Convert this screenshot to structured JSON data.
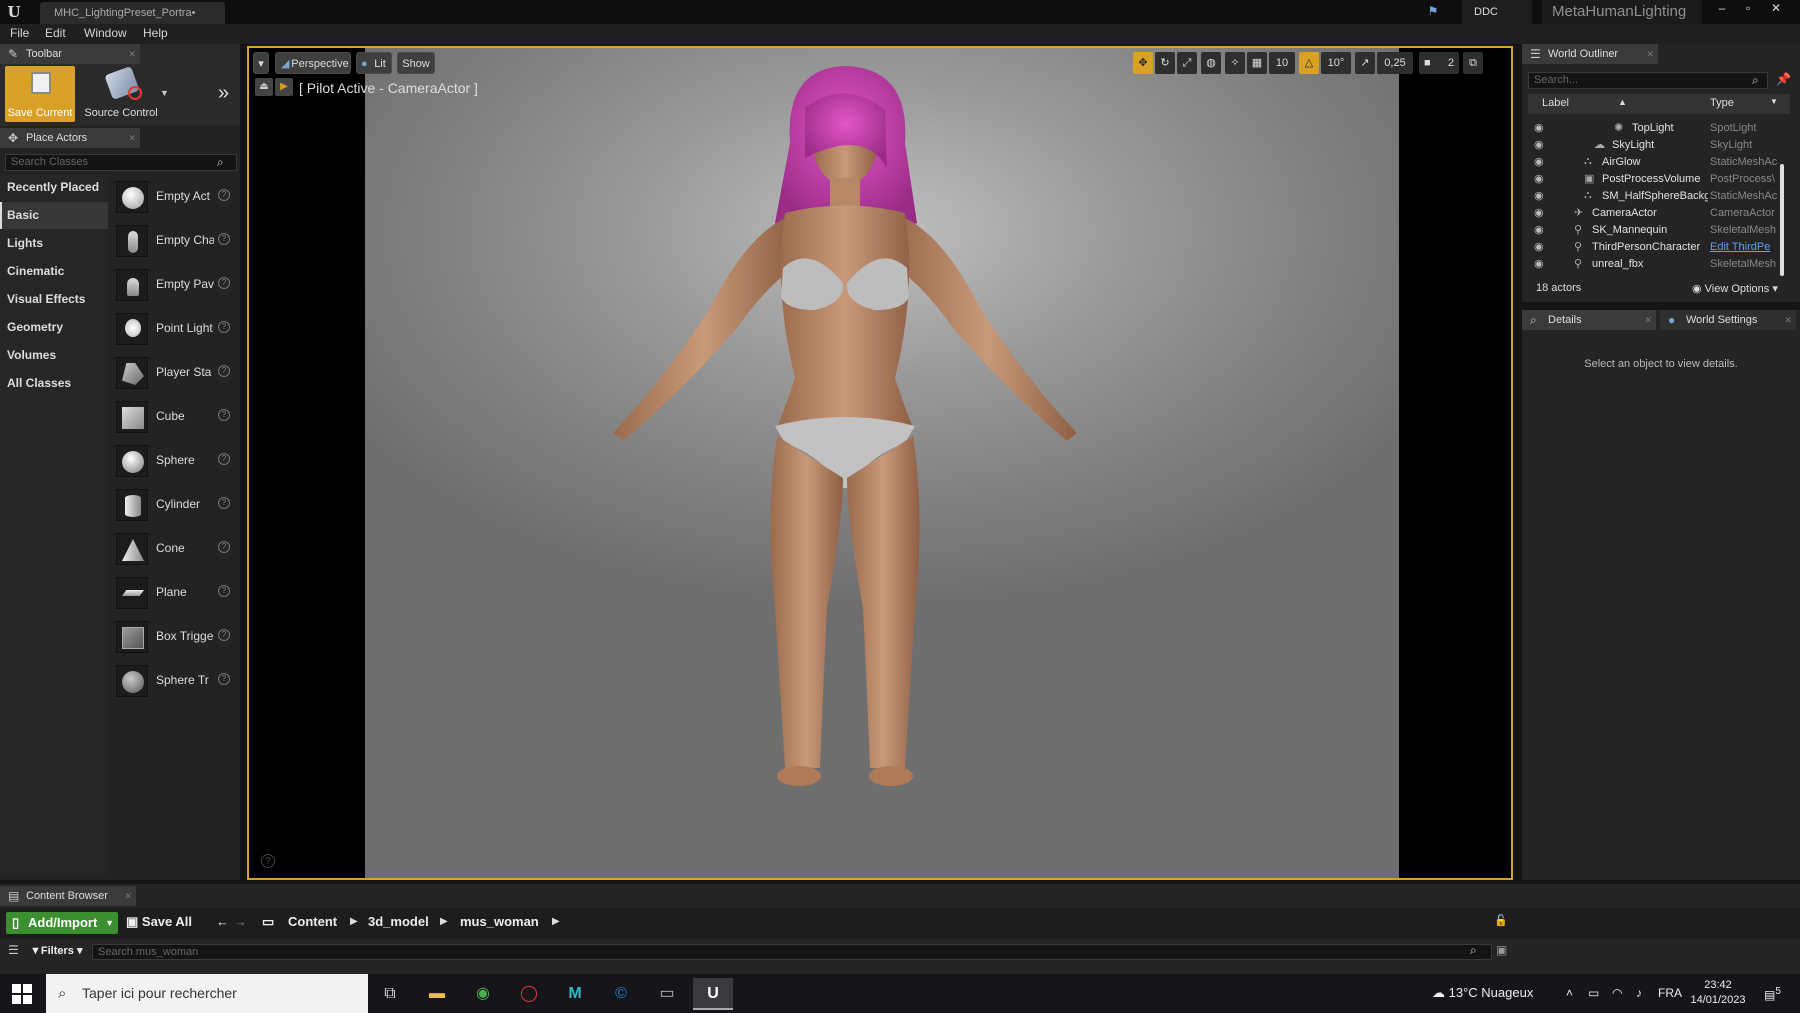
{
  "titlebar": {
    "tab_title": "MHC_LightingPreset_Portra•",
    "ddc": "DDC",
    "project": "MetaHumanLighting",
    "minimize": "–",
    "maximize": "▫",
    "close": "✕"
  },
  "menu": [
    "File",
    "Edit",
    "Window",
    "Help"
  ],
  "toolbar": {
    "tab": "Toolbar",
    "save_current": "Save Current",
    "source_control": "Source Control"
  },
  "place_actors": {
    "tab": "Place Actors",
    "search_placeholder": "Search Classes",
    "categories": [
      "Recently Placed",
      "Basic",
      "Lights",
      "Cinematic",
      "Visual Effects",
      "Geometry",
      "Volumes",
      "All Classes"
    ],
    "selected_category": "Basic",
    "actors": [
      "Empty Act",
      "Empty Cha",
      "Empty Pav",
      "Point Light",
      "Player Sta",
      "Cube",
      "Sphere",
      "Cylinder",
      "Cone",
      "Plane",
      "Box Trigge",
      "Sphere Tr"
    ],
    "help_glyph": "?"
  },
  "viewport": {
    "perspective": "Perspective",
    "lit": "Lit",
    "show": "Show",
    "pilot": "[ Pilot Active - CameraActor ]",
    "grid_snap": "10",
    "rotation_snap": "10°",
    "scale_snap": "0,25",
    "camera_speed": "2",
    "help_glyph": "?"
  },
  "outliner": {
    "tab": "World Outliner",
    "search_placeholder": "Search...",
    "col_label": "Label",
    "col_type": "Type",
    "rows": [
      {
        "label": "TopLight",
        "type": "SpotLight"
      },
      {
        "label": "SkyLight",
        "type": "SkyLight"
      },
      {
        "label": "AirGlow",
        "type": "StaticMeshAc"
      },
      {
        "label": "PostProcessVolume",
        "type": "PostProcess\\"
      },
      {
        "label": "SM_HalfSphereBackg",
        "type": "StaticMeshAc"
      },
      {
        "label": "CameraActor",
        "type": "CameraActor"
      },
      {
        "label": "SK_Mannequin",
        "type": "SkeletalMesh"
      },
      {
        "label": "ThirdPersonCharacter",
        "type": "Edit ThirdPe"
      },
      {
        "label": "unreal_fbx",
        "type": "SkeletalMesh"
      }
    ],
    "count": "18 actors",
    "view_options": "View Options"
  },
  "details": {
    "tab_details": "Details",
    "tab_world": "World Settings",
    "empty": "Select an object to view details."
  },
  "content_browser": {
    "tab": "Content Browser",
    "add_import": "Add/Import",
    "save_all": "Save All",
    "path": [
      "Content",
      "3d_model",
      "mus_woman"
    ],
    "filters": "Filters",
    "search_placeholder": "Search mus_woman"
  },
  "taskbar": {
    "search_placeholder": "Taper ici pour rechercher",
    "weather": "13°C  Nuageux",
    "lang": "FRA",
    "time": "23:42",
    "date": "14/01/2023",
    "notifications": "5"
  },
  "colors": {
    "accent": "#d9a128",
    "add_green": "#3c8f31",
    "link_blue": "#5aa2f0"
  }
}
